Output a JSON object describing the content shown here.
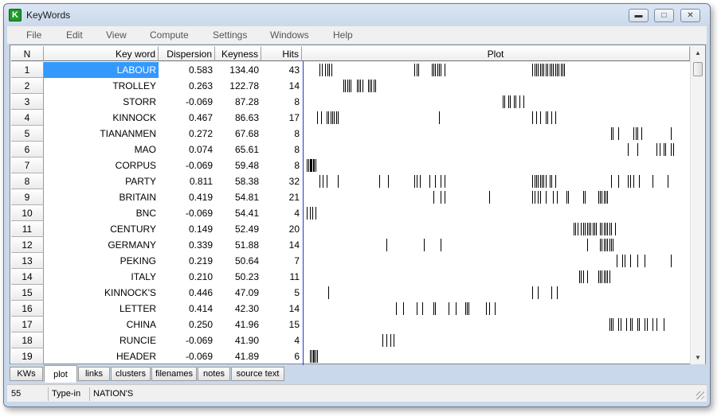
{
  "window": {
    "title": "KeyWords",
    "app_icon_letter": "K"
  },
  "menu": [
    "File",
    "Edit",
    "View",
    "Compute",
    "Settings",
    "Windows",
    "Help"
  ],
  "columns": {
    "n": "N",
    "keyword": "Key word",
    "dispersion": "Dispersion",
    "keyness": "Keyness",
    "hits": "Hits",
    "plot": "Plot"
  },
  "rows": [
    {
      "n": "1",
      "keyword": "LABOUR",
      "dispersion": "0.583",
      "keyness": "134.40",
      "hits": "43",
      "selected": true,
      "plot": [
        0.035,
        0.043,
        0.05,
        0.058,
        0.062,
        0.067,
        0.29,
        0.295,
        0.3,
        0.335,
        0.34,
        0.345,
        0.35,
        0.355,
        0.36,
        0.37,
        0.605,
        0.61,
        0.615,
        0.62,
        0.625,
        0.63,
        0.635,
        0.64,
        0.645,
        0.65,
        0.655,
        0.66,
        0.665,
        0.67,
        0.675,
        0.68,
        0.685,
        0.69
      ]
    },
    {
      "n": "2",
      "keyword": "TROLLEY",
      "dispersion": "0.263",
      "keyness": "122.78",
      "hits": "14",
      "plot": [
        0.1,
        0.105,
        0.11,
        0.115,
        0.12,
        0.135,
        0.14,
        0.145,
        0.15,
        0.165,
        0.17,
        0.175,
        0.18,
        0.185
      ]
    },
    {
      "n": "3",
      "keyword": "STORR",
      "dispersion": "-0.069",
      "keyness": "87.28",
      "hits": "8",
      "plot": [
        0.525,
        0.53,
        0.54,
        0.545,
        0.555,
        0.56,
        0.57,
        0.58
      ]
    },
    {
      "n": "4",
      "keyword": "KINNOCK",
      "dispersion": "0.467",
      "keyness": "86.63",
      "hits": "17",
      "plot": [
        0.03,
        0.04,
        0.055,
        0.06,
        0.065,
        0.07,
        0.075,
        0.08,
        0.085,
        0.355,
        0.605,
        0.615,
        0.625,
        0.64,
        0.645,
        0.655,
        0.665
      ]
    },
    {
      "n": "5",
      "keyword": "TIANANMEN",
      "dispersion": "0.272",
      "keyness": "67.68",
      "hits": "8",
      "plot": [
        0.815,
        0.82,
        0.835,
        0.875,
        0.88,
        0.885,
        0.895,
        0.975
      ]
    },
    {
      "n": "6",
      "keyword": "MAO",
      "dispersion": "0.074",
      "keyness": "65.61",
      "hits": "8",
      "plot": [
        0.86,
        0.885,
        0.935,
        0.945,
        0.955,
        0.96,
        0.975,
        0.98
      ]
    },
    {
      "n": "7",
      "keyword": "CORPUS",
      "dispersion": "-0.069",
      "keyness": "59.48",
      "hits": "8",
      "plot": [
        0.003,
        0.006,
        0.01,
        0.012,
        0.015,
        0.018,
        0.021,
        0.025
      ]
    },
    {
      "n": "8",
      "keyword": "PARTY",
      "dispersion": "0.811",
      "keyness": "58.38",
      "hits": "32",
      "plot": [
        0.035,
        0.045,
        0.055,
        0.085,
        0.195,
        0.22,
        0.29,
        0.295,
        0.305,
        0.33,
        0.345,
        0.36,
        0.37,
        0.605,
        0.61,
        0.615,
        0.62,
        0.625,
        0.63,
        0.635,
        0.64,
        0.65,
        0.655,
        0.665,
        0.815,
        0.835,
        0.86,
        0.865,
        0.875,
        0.89,
        0.925,
        0.965
      ]
    },
    {
      "n": "9",
      "keyword": "BRITAIN",
      "dispersion": "0.419",
      "keyness": "54.81",
      "hits": "21",
      "plot": [
        0.34,
        0.36,
        0.37,
        0.49,
        0.605,
        0.61,
        0.62,
        0.625,
        0.64,
        0.66,
        0.67,
        0.695,
        0.7,
        0.74,
        0.745,
        0.78,
        0.785,
        0.79,
        0.795,
        0.8,
        0.805
      ]
    },
    {
      "n": "10",
      "keyword": "BNC",
      "dispersion": "-0.069",
      "keyness": "54.41",
      "hits": "4",
      "plot": [
        0.003,
        0.01,
        0.017,
        0.025
      ]
    },
    {
      "n": "11",
      "keyword": "CENTURY",
      "dispersion": "0.149",
      "keyness": "52.49",
      "hits": "20",
      "plot": [
        0.715,
        0.72,
        0.725,
        0.735,
        0.74,
        0.745,
        0.75,
        0.755,
        0.76,
        0.765,
        0.77,
        0.775,
        0.785,
        0.79,
        0.795,
        0.8,
        0.805,
        0.81,
        0.815,
        0.825
      ]
    },
    {
      "n": "12",
      "keyword": "GERMANY",
      "dispersion": "0.339",
      "keyness": "51.88",
      "hits": "14",
      "plot": [
        0.215,
        0.315,
        0.36,
        0.75,
        0.785,
        0.79,
        0.795,
        0.8,
        0.805,
        0.81,
        0.815,
        0.82,
        0.795,
        0.8
      ]
    },
    {
      "n": "13",
      "keyword": "PEKING",
      "dispersion": "0.219",
      "keyness": "50.64",
      "hits": "7",
      "plot": [
        0.83,
        0.845,
        0.85,
        0.865,
        0.885,
        0.905,
        0.975
      ]
    },
    {
      "n": "14",
      "keyword": "ITALY",
      "dispersion": "0.210",
      "keyness": "50.23",
      "hits": "11",
      "plot": [
        0.73,
        0.735,
        0.74,
        0.75,
        0.78,
        0.785,
        0.79,
        0.795,
        0.8,
        0.805,
        0.81
      ]
    },
    {
      "n": "15",
      "keyword": "KINNOCK'S",
      "dispersion": "0.446",
      "keyness": "47.09",
      "hits": "5",
      "plot": [
        0.06,
        0.605,
        0.62,
        0.655,
        0.67
      ]
    },
    {
      "n": "16",
      "keyword": "LETTER",
      "dispersion": "0.414",
      "keyness": "42.30",
      "hits": "14",
      "plot": [
        0.24,
        0.26,
        0.295,
        0.31,
        0.34,
        0.345,
        0.38,
        0.4,
        0.425,
        0.43,
        0.435,
        0.48,
        0.49,
        0.505
      ]
    },
    {
      "n": "17",
      "keyword": "CHINA",
      "dispersion": "0.250",
      "keyness": "41.96",
      "hits": "15",
      "plot": [
        0.81,
        0.815,
        0.82,
        0.835,
        0.84,
        0.855,
        0.865,
        0.87,
        0.885,
        0.89,
        0.905,
        0.91,
        0.925,
        0.935,
        0.955
      ]
    },
    {
      "n": "18",
      "keyword": "RUNCIE",
      "dispersion": "-0.069",
      "keyness": "41.90",
      "hits": "4",
      "plot": [
        0.205,
        0.215,
        0.225,
        0.235
      ]
    },
    {
      "n": "19",
      "keyword": "HEADER",
      "dispersion": "-0.069",
      "keyness": "41.89",
      "hits": "6",
      "plot": [
        0.01,
        0.014,
        0.018,
        0.022,
        0.026,
        0.03
      ]
    }
  ],
  "tabs": [
    "KWs",
    "plot",
    "links",
    "clusters",
    "filenames",
    "notes",
    "source text"
  ],
  "active_tab": "plot",
  "status": {
    "count": "55",
    "mode": "Type-in",
    "word": "NATION'S"
  }
}
